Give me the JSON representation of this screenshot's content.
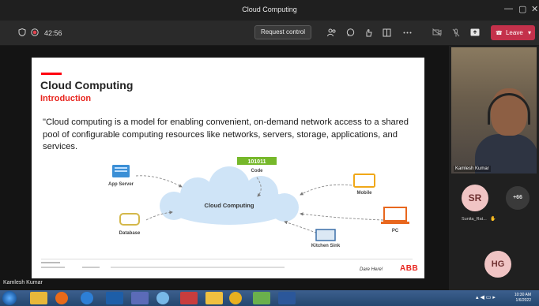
{
  "window": {
    "title": "Cloud Computing",
    "controls": [
      "—",
      "▢",
      "✕"
    ]
  },
  "toolbar": {
    "timer": "42:56",
    "request_control": "Request control",
    "leave": "Leave",
    "leave_color": "#c4314b"
  },
  "slide": {
    "heading": "Cloud Computing",
    "subheading": "Introduction",
    "quote": "\"Cloud computing is a model for enabling convenient, on-demand network access to a shared pool of configurable computing resources like networks, servers, storage, applications, and services.",
    "accent_color": "#e8261f",
    "diagram": {
      "center": "Cloud Computing",
      "nodes": [
        "App Server",
        "Code",
        "Mobile",
        "Database",
        "PC",
        "Kitchen Sink"
      ],
      "code_text": "101011"
    },
    "motto": "Dare Here!",
    "logo": "ABB"
  },
  "presenter_label": "Kamlesh Kumar",
  "participants": {
    "video_name": "Kamlesh Kumar",
    "sr_initials": "SR",
    "sr_name": "Sunita_Rat...",
    "more": "+66",
    "hg_initials": "HG"
  },
  "taskbar": {
    "time": "10:30 AM",
    "date": "1/6/2022"
  }
}
